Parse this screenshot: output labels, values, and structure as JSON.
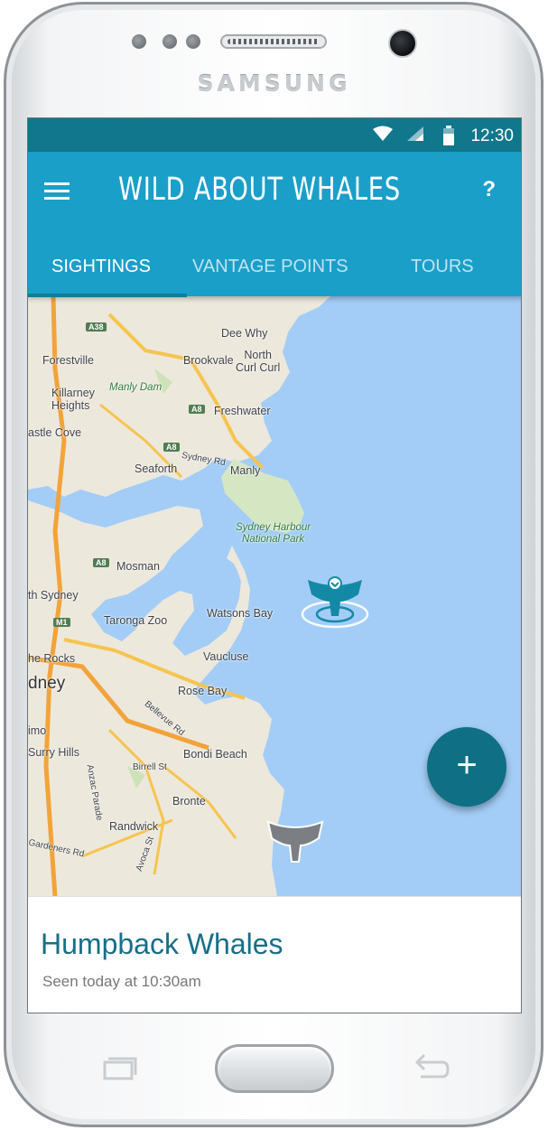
{
  "device": {
    "brand": "SAMSUNG"
  },
  "status_bar": {
    "time": "12:30",
    "icons": [
      "wifi-icon",
      "signal-icon",
      "battery-icon"
    ]
  },
  "app_bar": {
    "title": "WILD ABOUT WHALES",
    "menu_icon": "hamburger-menu-icon",
    "help_label": "?"
  },
  "tabs": [
    {
      "label": "SIGHTINGS",
      "active": true
    },
    {
      "label": "VANTAGE POINTS",
      "active": false
    },
    {
      "label": "TOURS",
      "active": false
    }
  ],
  "map": {
    "labels": {
      "dee_why": "Dee Why",
      "forestville": "Forestville",
      "brookvale": "Brookvale",
      "north_curl_curl": "North\nCurl Curl",
      "manly_dam": "Manly Dam",
      "killarney": "Killarney\nHeights",
      "freshwater": "Freshwater",
      "castle_cove": "astle Cove",
      "sydney_rd": "Sydney Rd",
      "seaforth": "Seaforth",
      "manly": "Manly",
      "harbour_np": "Sydney Harbour\nNational Park",
      "mosman": "Mosman",
      "north_sydney": "th Sydney",
      "taronga": "Taronga Zoo",
      "watsons_bay": "Watsons Bay",
      "the_rocks": "he Rocks",
      "vaucluse": "Vaucluse",
      "sydney": "dney",
      "rose_bay": "Rose Bay",
      "bellevue_rd": "Bellevue Rd",
      "imo": "imo",
      "surry_hills": "Surry Hills",
      "birrell_st": "Birrell St",
      "bondi_beach": "Bondi Beach",
      "anzac_parade": "Anzac Parade",
      "bronte": "Bronte",
      "randwick": "Randwick",
      "gardeners_rd": "Gardeners Rd",
      "avoca_st": "Avoca St"
    },
    "shields": {
      "a38": "A38",
      "a8a": "A8",
      "a8b": "A8",
      "a8c": "A8",
      "m1": "M1"
    },
    "markers": [
      {
        "name": "whale-tail-marker-selected",
        "color": "#1489a6"
      },
      {
        "name": "whale-tail-marker",
        "color": "#7b7f84"
      }
    ]
  },
  "fab": {
    "label": "+"
  },
  "sighting_card": {
    "title": "Humpback Whales",
    "subtitle": "Seen today at 10:30am"
  },
  "colors": {
    "status_bar": "#10778c",
    "app_bar": "#1a9fc9",
    "tab_indicator": "#0f7e97",
    "fab": "#0f6f84",
    "card_title": "#176f86",
    "water": "#a3cdf6",
    "land": "#ede8dc"
  }
}
